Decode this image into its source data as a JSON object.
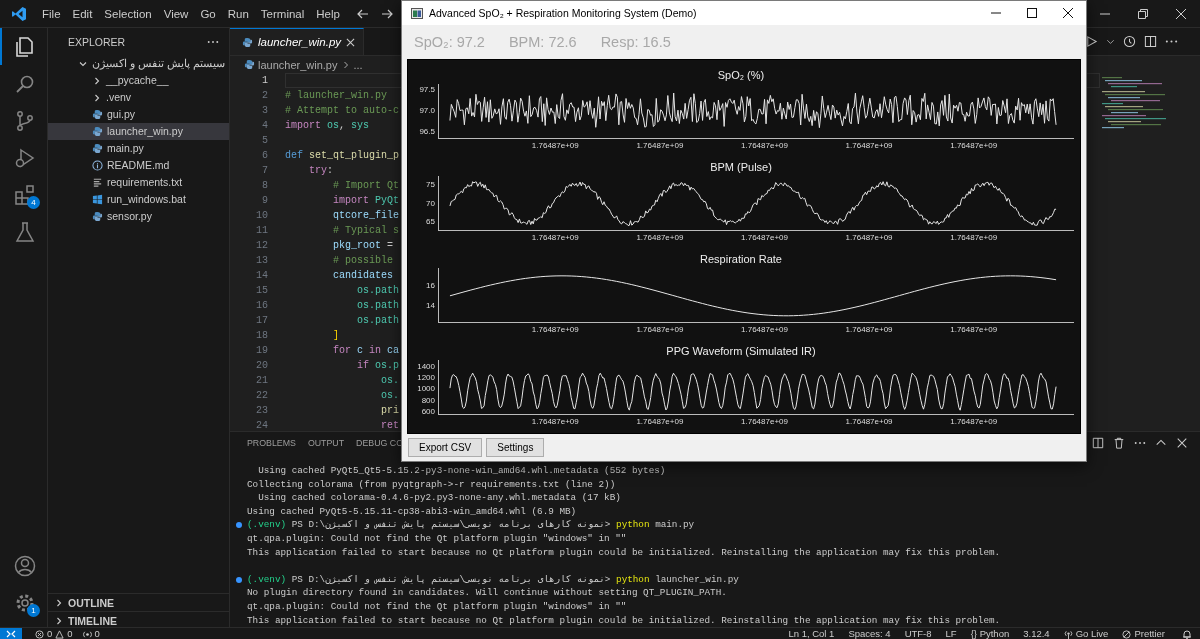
{
  "menu": [
    "File",
    "Edit",
    "Selection",
    "View",
    "Go",
    "Run",
    "Terminal",
    "Help"
  ],
  "activity_bar": [
    {
      "selected": true
    },
    {
      "selected": false
    },
    {
      "selected": false
    },
    {
      "selected": false
    },
    {
      "selected": false,
      "badge": "4"
    },
    {
      "selected": false
    }
  ],
  "activity_bottom": [
    {
      "selected": false
    },
    {
      "selected": false,
      "badge": "1"
    }
  ],
  "explorer": {
    "title": "EXPLORER",
    "tree": [
      {
        "label": "سیستم پایش تنفس و اکسیژن",
        "kind": "folder",
        "expanded": true,
        "selected": false,
        "children": [
          {
            "label": "__pycache__",
            "kind": "folder",
            "expanded": false,
            "selected": false
          },
          {
            "label": ".venv",
            "kind": "folder",
            "expanded": false,
            "selected": false
          },
          {
            "label": "gui.py",
            "kind": "python",
            "selected": false
          },
          {
            "label": "launcher_win.py",
            "kind": "python",
            "selected": true
          },
          {
            "label": "main.py",
            "kind": "python",
            "selected": false
          },
          {
            "label": "README.md",
            "kind": "markdown",
            "selected": false
          },
          {
            "label": "requirements.txt",
            "kind": "text",
            "selected": false
          },
          {
            "label": "run_windows.bat",
            "kind": "batch",
            "selected": false
          },
          {
            "label": "sensor.py",
            "kind": "python",
            "selected": false
          }
        ]
      }
    ],
    "sections": [
      {
        "label": "OUTLINE",
        "expanded": false
      },
      {
        "label": "TIMELINE",
        "expanded": false
      }
    ]
  },
  "editor": {
    "tabs": [
      {
        "label": "launcher_win.py",
        "selected": true,
        "preview": true
      }
    ],
    "breadcrumb": [
      "launcher_win.py",
      "..."
    ],
    "lines": [
      {
        "number": "1",
        "current": true
      },
      {
        "number": "2",
        "current": false,
        "tokens": [
          {
            "text": "# launcher_win.py",
            "kind": "comment"
          }
        ]
      },
      {
        "number": "3",
        "current": false,
        "tokens": [
          {
            "text": "# Attempt to auto-c",
            "kind": "comment"
          }
        ]
      },
      {
        "number": "4",
        "current": false,
        "tokens": [
          {
            "text": "import",
            "kind": "control"
          },
          {
            "text": " os",
            "kind": "module"
          },
          {
            "text": ", ",
            "kind": "plain"
          },
          {
            "text": "sys",
            "kind": "module"
          }
        ]
      },
      {
        "number": "5",
        "current": false
      },
      {
        "number": "6",
        "current": false,
        "tokens": [
          {
            "text": "def",
            "kind": "keyword"
          },
          {
            "text": " set_qt_plugin_p",
            "kind": "function"
          }
        ]
      },
      {
        "number": "7",
        "current": false,
        "tokens": [
          {
            "text": "    try",
            "kind": "control"
          },
          {
            "text": ":",
            "kind": "plain"
          }
        ]
      },
      {
        "number": "8",
        "current": false,
        "tokens": [
          {
            "text": "        # Import Qt",
            "kind": "comment"
          }
        ]
      },
      {
        "number": "9",
        "current": false,
        "tokens": [
          {
            "text": "        import",
            "kind": "control"
          },
          {
            "text": " PyQt",
            "kind": "module"
          }
        ]
      },
      {
        "number": "10",
        "current": false,
        "tokens": [
          {
            "text": "        qtcore_file",
            "kind": "variable"
          }
        ]
      },
      {
        "number": "11",
        "current": false,
        "tokens": [
          {
            "text": "        # Typical s",
            "kind": "comment"
          }
        ]
      },
      {
        "number": "12",
        "current": false,
        "tokens": [
          {
            "text": "        pkg_root",
            "kind": "variable"
          },
          {
            "text": " =",
            "kind": "plain"
          }
        ]
      },
      {
        "number": "13",
        "current": false,
        "tokens": [
          {
            "text": "        # possible",
            "kind": "comment"
          }
        ]
      },
      {
        "number": "14",
        "current": false,
        "tokens": [
          {
            "text": "        candidates",
            "kind": "variable"
          }
        ]
      },
      {
        "number": "15",
        "current": false,
        "tokens": [
          {
            "text": "            os.path",
            "kind": "module"
          }
        ]
      },
      {
        "number": "16",
        "current": false,
        "tokens": [
          {
            "text": "            os.path",
            "kind": "module"
          }
        ]
      },
      {
        "number": "17",
        "current": false,
        "tokens": [
          {
            "text": "            os.path",
            "kind": "module"
          }
        ]
      },
      {
        "number": "18",
        "current": false,
        "tokens": [
          {
            "text": "        ]",
            "kind": "bracket"
          }
        ]
      },
      {
        "number": "19",
        "current": false,
        "tokens": [
          {
            "text": "        for",
            "kind": "control"
          },
          {
            "text": " c ",
            "kind": "variable"
          },
          {
            "text": "in",
            "kind": "control"
          },
          {
            "text": " ca",
            "kind": "variable"
          }
        ]
      },
      {
        "number": "20",
        "current": false,
        "tokens": [
          {
            "text": "            if",
            "kind": "control"
          },
          {
            "text": " os.p",
            "kind": "module"
          }
        ]
      },
      {
        "number": "21",
        "current": false,
        "tokens": [
          {
            "text": "                os.",
            "kind": "module"
          }
        ]
      },
      {
        "number": "22",
        "current": false,
        "tokens": [
          {
            "text": "                os.",
            "kind": "module"
          }
        ]
      },
      {
        "number": "23",
        "current": false,
        "tokens": [
          {
            "text": "                pri",
            "kind": "function"
          }
        ]
      },
      {
        "number": "24",
        "current": false,
        "tokens": [
          {
            "text": "                ret",
            "kind": "control"
          }
        ]
      }
    ]
  },
  "panel": {
    "tabs": [
      {
        "label": "PROBLEMS",
        "selected": false
      },
      {
        "label": "OUTPUT",
        "selected": false
      },
      {
        "label": "DEBUG CO",
        "selected": false
      }
    ],
    "terminal": [
      {
        "kind": "text",
        "text": "  Using cached PyQt5_Qt5-5.15.2-py3-none-win_amd64.whl.metadata (552 bytes)"
      },
      {
        "kind": "text",
        "text": "Collecting colorama (from pyqtgraph->-r requirements.txt (line 2))"
      },
      {
        "kind": "text",
        "text": "  Using cached colorama-0.4.6-py2.py3-none-any.whl.metadata (17 kB)"
      },
      {
        "kind": "text",
        "text": "Using cached PyQt5-5.15.11-cp38-abi3-win_amd64.whl (6.9 MB)"
      },
      {
        "kind": "prompt",
        "venv": "(.venv)",
        "path": "PS D:\\نمونه کارهای برنامه نویسی\\سیستم پایش تنفس و اکسیژن>",
        "command": "python",
        "args": "main.py"
      },
      {
        "kind": "text",
        "text": "qt.qpa.plugin: Could not find the Qt platform plugin \"windows\" in \"\""
      },
      {
        "kind": "text",
        "text": "This application failed to start because no Qt platform plugin could be initialized. Reinstalling the application may fix this problem."
      },
      {
        "kind": "blank"
      },
      {
        "kind": "prompt",
        "venv": "(.venv)",
        "path": "PS D:\\نمونه کارهای برنامه نویسی\\سیستم پایش تنفس و اکسیژن>",
        "command": "python",
        "args": "launcher_win.py"
      },
      {
        "kind": "text",
        "text": "No plugin directory found in candidates. Will continue without setting QT_PLUGIN_PATH."
      },
      {
        "kind": "text",
        "text": "qt.qpa.plugin: Could not find the Qt platform plugin \"windows\" in \"\""
      },
      {
        "kind": "text",
        "text": "This application failed to start because no Qt platform plugin could be initialized. Reinstalling the application may fix this problem."
      }
    ]
  },
  "status_bar": {
    "errors": "0",
    "warnings": "0",
    "ports": "0",
    "items": [
      {
        "kind": "text",
        "label": "Ln 1, Col 1"
      },
      {
        "kind": "text",
        "label": "Spaces: 4"
      },
      {
        "kind": "text",
        "label": "UTF-8"
      },
      {
        "kind": "text",
        "label": "LF"
      },
      {
        "kind": "text",
        "label": "{} Python"
      },
      {
        "kind": "text",
        "label": "3.12.4"
      },
      {
        "kind": "golive",
        "label": "Go Live"
      },
      {
        "kind": "prettier",
        "label": "Prettier"
      }
    ]
  },
  "monitor": {
    "title": "Advanced SpO₂ + Respiration Monitoring System (Demo)",
    "readouts": [
      "SpO₂: 97.2",
      "BPM: 72.6",
      "Resp: 16.5"
    ],
    "plots": [
      {
        "title": "SpO₂ (%)",
        "kind": "spo2",
        "y_ticks": [
          "97.5",
          "97.0",
          "96.5"
        ],
        "x_ticks": [
          "1.76487e+09",
          "1.76487e+09",
          "1.76487e+09",
          "1.76487e+09",
          "1.76487e+09"
        ]
      },
      {
        "title": "BPM (Pulse)",
        "kind": "pulse",
        "y_ticks": [
          "75",
          "70",
          "65"
        ],
        "x_ticks": [
          "1.76487e+09",
          "1.76487e+09",
          "1.76487e+09",
          "1.76487e+09",
          "1.76487e+09"
        ]
      },
      {
        "title": "Respiration Rate",
        "kind": "breath",
        "y_ticks": [
          "16",
          "14"
        ],
        "x_ticks": [
          "1.76487e+09",
          "1.76487e+09",
          "1.76487e+09",
          "1.76487e+09",
          "1.76487e+09"
        ]
      },
      {
        "title": "PPG Waveform (Simulated IR)",
        "kind": "ppg",
        "y_ticks": [
          "1400",
          "1200",
          "1000",
          "800",
          "600"
        ],
        "x_ticks": [
          "1.76487e+09",
          "1.76487e+09",
          "1.76487e+09",
          "1.76487e+09",
          "1.76487e+09"
        ]
      }
    ],
    "buttons": [
      "Export CSV",
      "Settings"
    ]
  }
}
